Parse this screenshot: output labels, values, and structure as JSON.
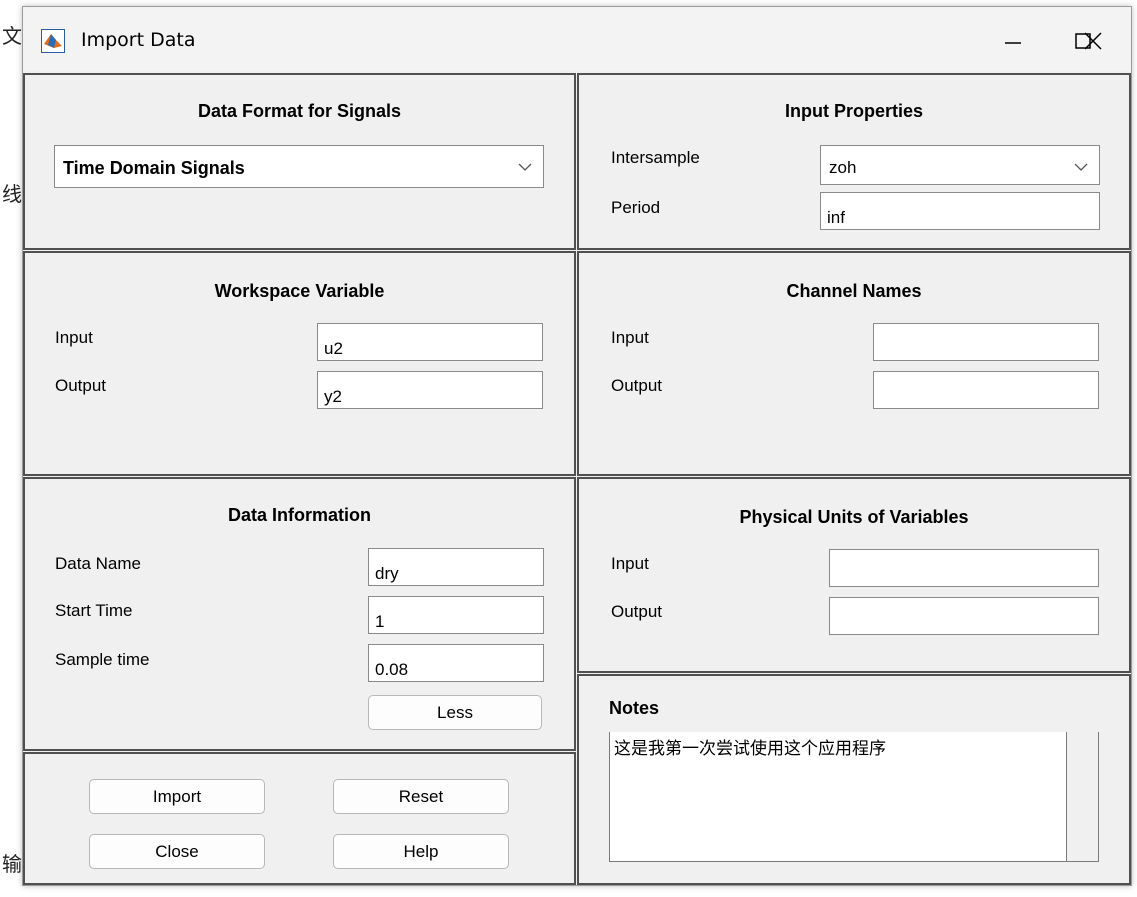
{
  "background_fragments": [
    "文",
    "线",
    "输"
  ],
  "window": {
    "title": "Import Data",
    "icon": "matlab-icon",
    "controls": [
      "minimize-icon",
      "maximize-icon",
      "close-icon"
    ]
  },
  "data_format": {
    "title": "Data Format for Signals",
    "selected": "Time Domain Signals"
  },
  "input_properties": {
    "title": "Input Properties",
    "intersample_label": "Intersample",
    "intersample_value": "zoh",
    "period_label": "Period",
    "period_value": "inf"
  },
  "workspace_variable": {
    "title": "Workspace Variable",
    "input_label": "Input",
    "input_value": "u2",
    "output_label": "Output",
    "output_value": "y2"
  },
  "channel_names": {
    "title": "Channel Names",
    "input_label": "Input",
    "input_value": "",
    "output_label": "Output",
    "output_value": ""
  },
  "data_information": {
    "title": "Data Information",
    "data_name_label": "Data Name",
    "data_name_value": "dry",
    "start_time_label": "Start Time",
    "start_time_value": "1",
    "sample_time_label": "Sample time",
    "sample_time_value": "0.08",
    "less_button": "Less"
  },
  "physical_units": {
    "title": "Physical Units of Variables",
    "input_label": "Input",
    "input_value": "",
    "output_label": "Output",
    "output_value": ""
  },
  "notes": {
    "title": "Notes",
    "text": "这是我第一次尝试使用这个应用程序"
  },
  "buttons": {
    "import": "Import",
    "reset": "Reset",
    "close": "Close",
    "help": "Help"
  },
  "colors": {
    "dialog_bg": "#f0f0f0",
    "panel_border": "#505050",
    "field_bg": "#ffffff"
  }
}
